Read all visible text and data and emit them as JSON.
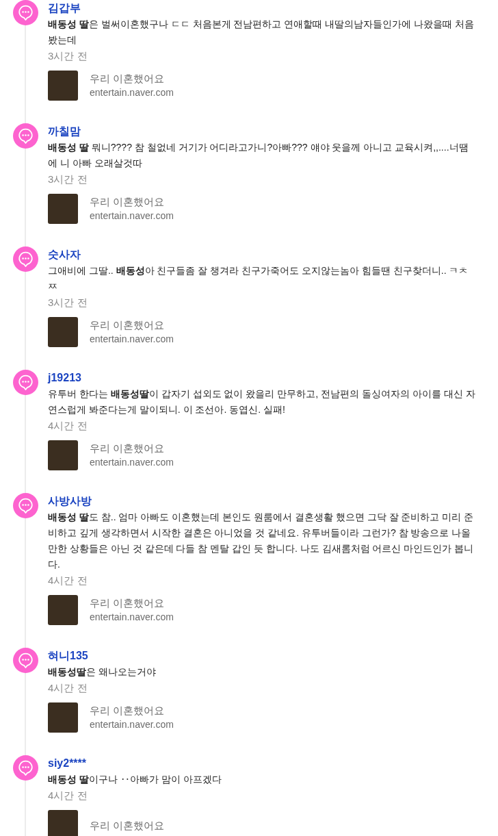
{
  "comments": [
    {
      "author": "김갑부",
      "body": "**배동성 딸**은 벌써이혼했구나 ㄷㄷ 처음본게 전남편하고 연애할때 내딸의남자들인가에 나왔을때 처음봤는데",
      "time": "3시간 전",
      "link": {
        "title": "우리 이혼했어요",
        "domain": "entertain.naver.com"
      }
    },
    {
      "author": "까칠맘",
      "body": "**배동성 딸** 뭐니???? 참 철없네 거기가 어디라고가니?아빠??? 얘야 웃을께 아니고 교육시켜,,....너땜에 니 아빠 오래살것따",
      "time": "3시간 전",
      "link": {
        "title": "우리 이혼했어요",
        "domain": "entertain.naver.com"
      }
    },
    {
      "author": "숫사자",
      "body": "그애비에 그딸.. **배동성**아 친구들좀 잘 챙겨라 친구가죽어도 오지않는놈아 힘들땐 친구찾더니.. ㅋㅊㅉ",
      "time": "3시간 전",
      "link": {
        "title": "우리 이혼했어요",
        "domain": "entertain.naver.com"
      }
    },
    {
      "author": "j19213",
      "body": "유투버 한다는 **배동성딸**이 갑자기 섭외도 없이 왔을리 만무하고, 전남편의 돌싱여자의 아이를 대신 자연스럽게 봐준다는게 말이되니. 이 조선아. 동엽신. 실패!",
      "time": "4시간 전",
      "link": {
        "title": "우리 이혼했어요",
        "domain": "entertain.naver.com"
      }
    },
    {
      "author": "사방사방",
      "body": "**배동성 딸**도 참.. 엄마 아빠도 이혼했는데 본인도 원룸에서 결혼생활 했으면 그닥 잘 준비하고 미리 준비하고 깊게 생각하면서 시작한 결혼은 아니었을 것 같네요. 유투버들이라 그런가? 참 방송으로 나올만한 상황들은 아닌 것 같은데 다들 참 멘탈 갑인 듯 합니다. 나도 김새롬처럼 어르신 마인드인가 봅니다.",
      "time": "4시간 전",
      "link": {
        "title": "우리 이혼했어요",
        "domain": "entertain.naver.com"
      }
    },
    {
      "author": "혀니135",
      "body": "**배동성딸**은 왜나오는거야",
      "time": "4시간 전",
      "link": {
        "title": "우리 이혼했어요",
        "domain": "entertain.naver.com"
      }
    },
    {
      "author": "siy2****",
      "body": "**배동성 딸**이구나 ‥아빠가 맘이 아프겠다",
      "time": "4시간 전",
      "link": {
        "title": "우리 이혼했어요"
      }
    }
  ]
}
